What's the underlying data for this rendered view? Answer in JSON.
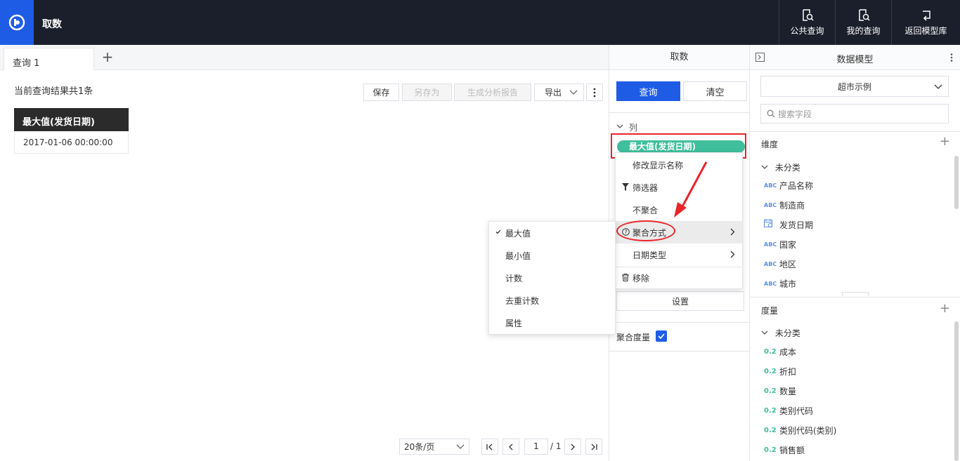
{
  "header": {
    "app_title": "取数",
    "actions": [
      {
        "label": "公共查询",
        "icon": "public-query-icon"
      },
      {
        "label": "我的查询",
        "icon": "my-query-icon"
      },
      {
        "label": "返回模型库",
        "icon": "return-icon"
      }
    ]
  },
  "tabs": [
    {
      "label": "查询 1"
    }
  ],
  "result": {
    "summary": "当前查询结果共1条",
    "toolbar": {
      "save": "保存",
      "save_as": "另存为",
      "gen_report": "生成分析报告",
      "export": "导出"
    },
    "table": {
      "headers": [
        "最大值(发货日期)"
      ],
      "rows": [
        [
          "2017-01-06 00:00:00"
        ]
      ]
    }
  },
  "pagination": {
    "page_size": "20条/页",
    "current_page": "1",
    "total_pages": "/ 1"
  },
  "fetch_panel": {
    "title": "取数",
    "query_button": "查询",
    "clear_button": "清空",
    "columns_label": "列",
    "column_pill": "最大值(发货日期)",
    "settings_button": "设置",
    "aggregate_measure_label": "聚合度量",
    "aggregate_measure_checked": true
  },
  "context_menu": {
    "items": [
      "修改显示名称",
      "筛选器",
      "不聚合",
      "聚合方式",
      "日期类型",
      "移除"
    ]
  },
  "aggregation_submenu": {
    "items": [
      "最大值",
      "最小值",
      "计数",
      "去重计数",
      "属性"
    ],
    "selected": "最大值"
  },
  "data_model": {
    "title": "数据模型",
    "model_select": "超市示例",
    "search_placeholder": "搜索字段",
    "dimensions": {
      "label": "维度",
      "group": "未分类",
      "fields": [
        {
          "type": "ABC",
          "name": "产品名称"
        },
        {
          "type": "date",
          "name": "制造商"
        },
        {
          "type": "date",
          "name": "发货日期"
        },
        {
          "type": "ABC",
          "name": "国家"
        },
        {
          "type": "ABC",
          "name": "地区"
        },
        {
          "type": "ABC",
          "name": "城市"
        }
      ]
    },
    "measures": {
      "label": "度量",
      "group": "未分类",
      "type_glyph": "0.2",
      "fields": [
        "成本",
        "折扣",
        "数量",
        "类别代码",
        "类别代码(类别)",
        "销售额"
      ]
    }
  },
  "colors": {
    "primary": "#1e5ce6",
    "topbar": "#1b1f2b",
    "pill": "#3fbf9c",
    "highlight": "#e8252a"
  }
}
